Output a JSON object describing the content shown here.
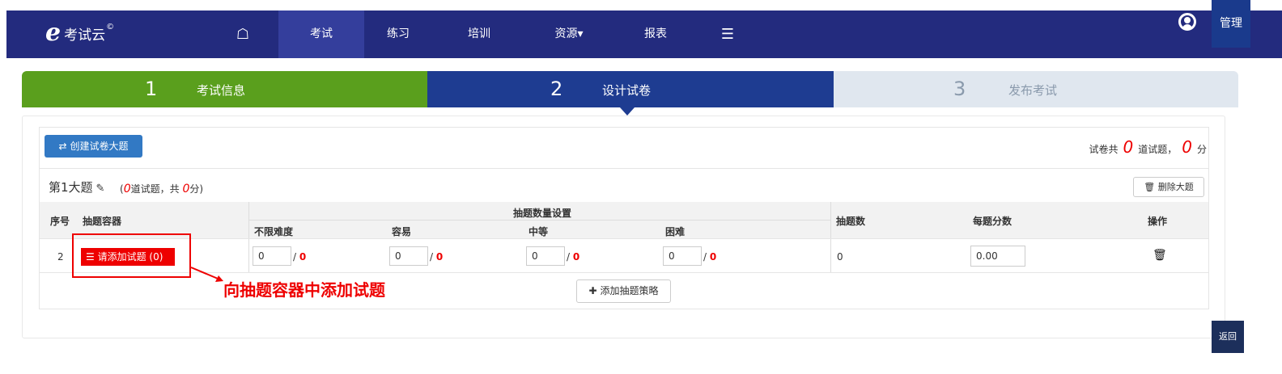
{
  "nav": {
    "logo_text": "考试云",
    "logo_mark": "©",
    "home_icon": "home-icon",
    "items": [
      {
        "label": "考试",
        "active": true
      },
      {
        "label": "练习"
      },
      {
        "label": "培训"
      },
      {
        "label": "资源▾"
      },
      {
        "label": "报表"
      }
    ],
    "menu_icon": "list-icon",
    "user_icon": "user-circle-icon",
    "admin_label": "管理",
    "colors": {
      "bar": "#232b7e",
      "active": "#343e9c"
    }
  },
  "steps": [
    {
      "num": "1",
      "label": "考试信息",
      "state": "done",
      "color": "#5a9f1d"
    },
    {
      "num": "2",
      "label": "设计试卷",
      "state": "current",
      "color": "#1e3c91"
    },
    {
      "num": "3",
      "label": "发布考试",
      "state": "pending",
      "color": "#e0e7ef"
    }
  ],
  "toolbar": {
    "create_label": "创建试卷大题",
    "total_prefix": "试卷共",
    "total_count": "0",
    "total_mid": "道试题，",
    "total_score": "0",
    "total_suffix": "分"
  },
  "section": {
    "title": "第1大题",
    "info_open": "(",
    "count": "0",
    "info_mid": "道试题，共",
    "score": "0",
    "info_close": "分)",
    "delete_label": "删除大题"
  },
  "table": {
    "headers": {
      "index": "序号",
      "container": "抽题容器",
      "settings": "抽题数量设置",
      "any": "不限难度",
      "easy": "容易",
      "medium": "中等",
      "hard": "困难",
      "pick_count": "抽题数",
      "per_score": "每题分数",
      "action": "操作"
    },
    "rows": [
      {
        "index": "2",
        "container_label": "请添加试题 (0)",
        "any": {
          "value": "0",
          "max": "0"
        },
        "easy": {
          "value": "0",
          "max": "0"
        },
        "medium": {
          "value": "0",
          "max": "0"
        },
        "hard": {
          "value": "0",
          "max": "0"
        },
        "pick_count": "0",
        "per_score": "0.00"
      }
    ],
    "add_strategy_label": "添加抽题策略"
  },
  "annotation": "向抽题容器中添加试题",
  "back_label": "返回"
}
